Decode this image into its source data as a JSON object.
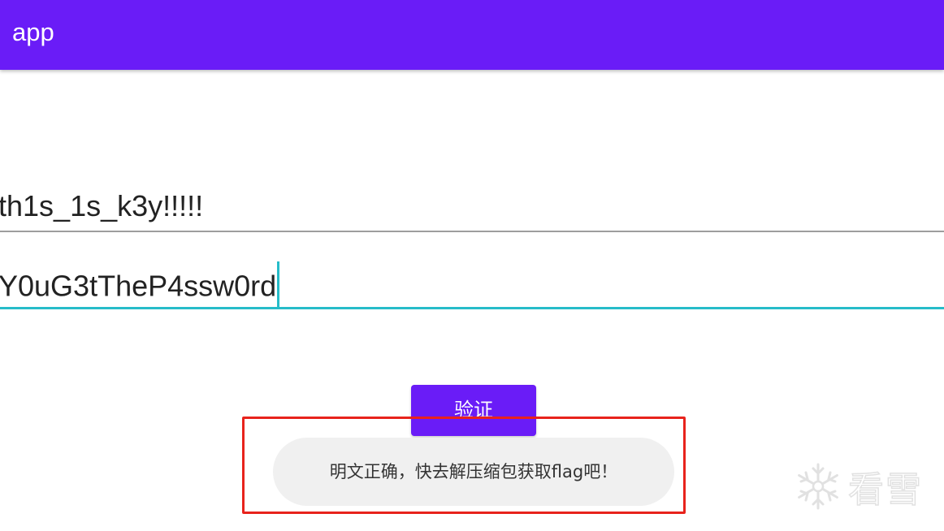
{
  "app_bar": {
    "title": "app",
    "color": "#6a1cf7"
  },
  "form": {
    "key_field": {
      "value": "th1s_1s_k3y!!!!!"
    },
    "password_field": {
      "value": "Y0uG3tTheP4ssw0rd",
      "focused": true,
      "accent_color": "#26bcc9"
    },
    "verify_button_label": "验证"
  },
  "toast": {
    "message": "明文正确，快去解压缩包获取flag吧！"
  },
  "annotation": {
    "color": "#e8231c"
  },
  "watermark": {
    "icon": "snowflake-icon",
    "text": "看雪"
  }
}
